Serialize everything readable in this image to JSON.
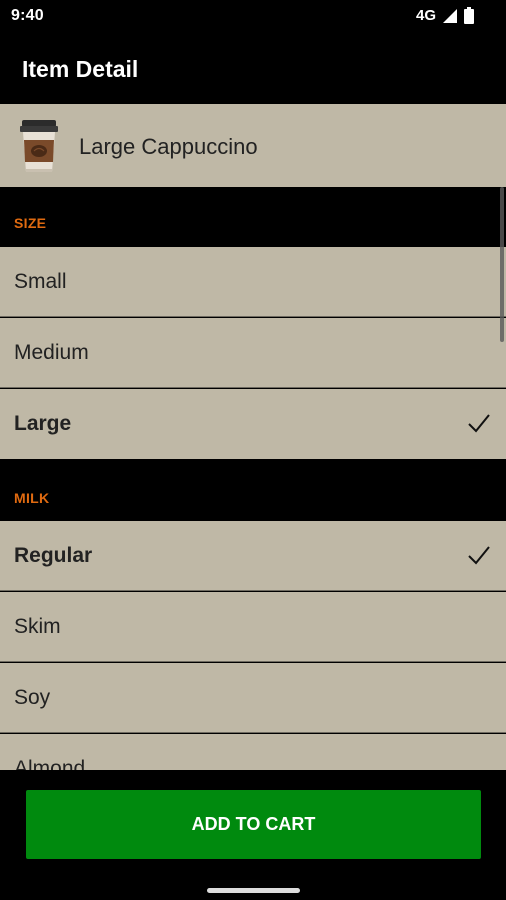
{
  "status_bar": {
    "time": "9:40",
    "network": "4G"
  },
  "app_bar": {
    "title": "Item Detail"
  },
  "item": {
    "name": "Large Cappuccino",
    "icon": "coffee-cup-icon"
  },
  "sections": [
    {
      "title": "SIZE",
      "options": [
        {
          "label": "Small",
          "selected": false
        },
        {
          "label": "Medium",
          "selected": false
        },
        {
          "label": "Large",
          "selected": true
        }
      ]
    },
    {
      "title": "MILK",
      "options": [
        {
          "label": "Regular",
          "selected": true
        },
        {
          "label": "Skim",
          "selected": false
        },
        {
          "label": "Soy",
          "selected": false
        },
        {
          "label": "Almond",
          "selected": false
        }
      ]
    }
  ],
  "actions": {
    "add_to_cart": "ADD TO CART"
  },
  "colors": {
    "accent": "#e06a10",
    "button": "#008a0e",
    "row_bg": "#bfb8a6"
  }
}
